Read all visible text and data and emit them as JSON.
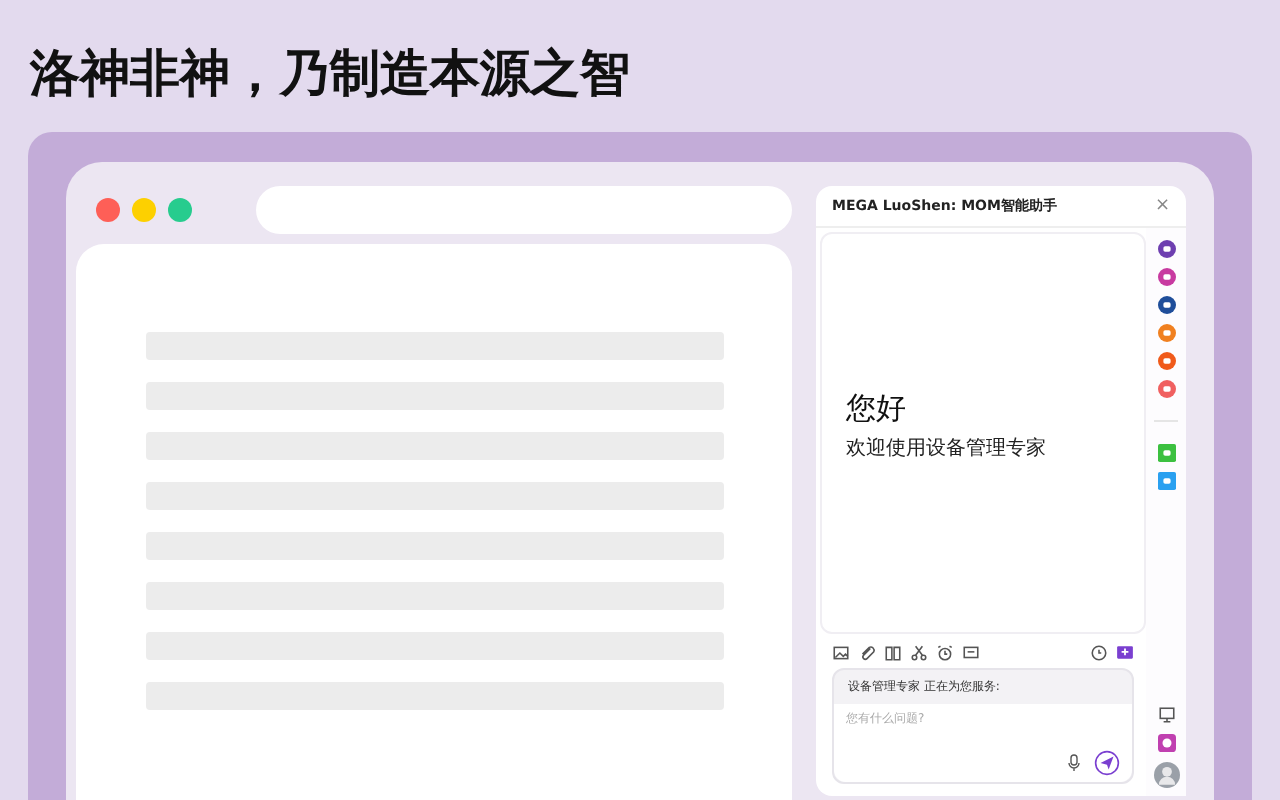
{
  "headline": "洛神非神，乃制造本源之智",
  "assistant": {
    "title": "MEGA LuoShen: MOM智能助手",
    "close": "×",
    "greeting": "您好",
    "welcome": "欢迎使用设备管理专家",
    "status": "设备管理专家 正在为您服务:",
    "input": {
      "placeholder": "您有什么问题?"
    }
  },
  "apps": [
    {
      "kind": "round",
      "color": "#6e3fb0"
    },
    {
      "kind": "round",
      "color": "#c83aa0"
    },
    {
      "kind": "round",
      "color": "#1f4e9a"
    },
    {
      "kind": "round",
      "color": "#f08020"
    },
    {
      "kind": "round",
      "color": "#f05a1a"
    },
    {
      "kind": "round",
      "color": "#f06060"
    },
    {
      "kind": "divider"
    },
    {
      "kind": "square",
      "color": "#3cc040"
    },
    {
      "kind": "square",
      "color": "#2aa0f0"
    }
  ]
}
